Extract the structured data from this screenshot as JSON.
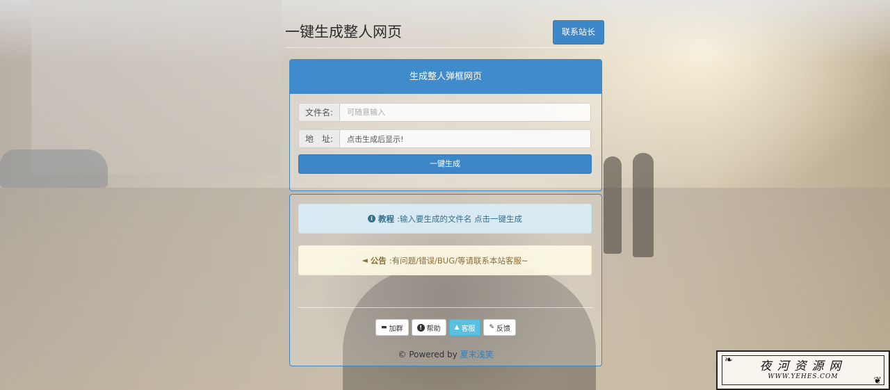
{
  "header": {
    "title": "一键生成整人网页",
    "contact_button": "联系站长"
  },
  "generator": {
    "panel_title": "生成整人弹框网页",
    "filename_label": "文件名:",
    "filename_placeholder": "可随意输入",
    "address_label": "地　址:",
    "address_value": "点击生成后显示!",
    "generate_button": "一键生成"
  },
  "info": {
    "tutorial_label": "教程",
    "tutorial_text": ":输入要生成的文件名 点击一键生成",
    "notice_label": "公告",
    "notice_text": ":有问题/错误/BUG/等请联系本站客服~"
  },
  "footer": {
    "buttons": [
      {
        "label": "加群",
        "icon": "card-icon"
      },
      {
        "label": "帮助",
        "icon": "info-icon"
      },
      {
        "label": "客服",
        "icon": "user-icon"
      },
      {
        "label": "反馈",
        "icon": "pencil-icon"
      }
    ],
    "powered_prefix": "© Powered by ",
    "powered_link": "夏末浅笑"
  },
  "watermark": {
    "title": "夜河资源网",
    "url": "WWW.YEHES.COM"
  },
  "colors": {
    "primary": "#3d87c9",
    "info_bg": "#d9edf7",
    "warning_bg": "#fcf8e3",
    "active_button": "#5bc0de"
  }
}
